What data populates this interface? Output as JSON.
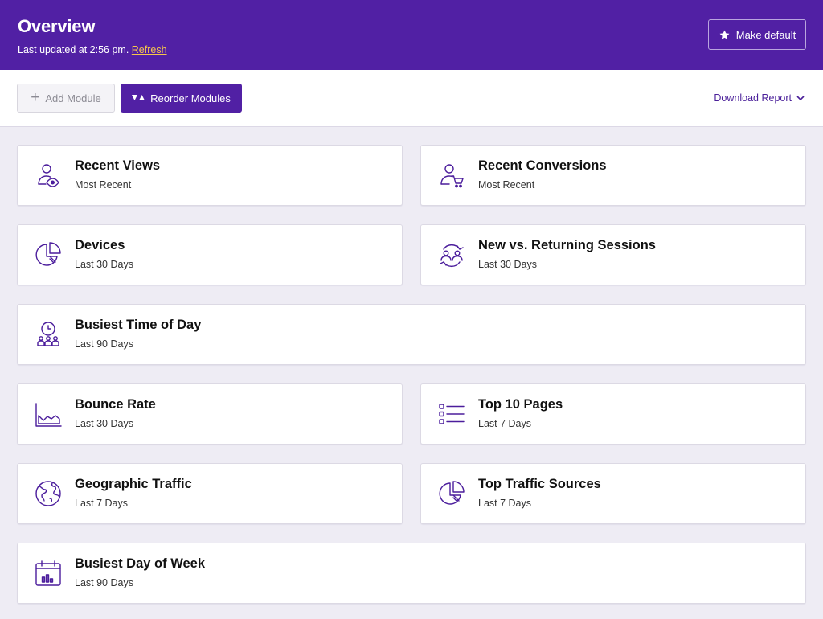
{
  "header": {
    "title": "Overview",
    "last_updated": "Last updated at 2:56 pm.",
    "refresh_label": "Refresh",
    "make_default_label": "Make default",
    "background_color": "#5120a4"
  },
  "toolbar": {
    "add_module_label": "Add Module",
    "reorder_modules_label": "Reorder Modules",
    "download_report_label": "Download Report"
  },
  "modules": [
    {
      "title": "Recent Views",
      "subtitle": "Most Recent",
      "icon": "user-eye-icon"
    },
    {
      "title": "Recent Conversions",
      "subtitle": "Most Recent",
      "icon": "user-cart-icon"
    },
    {
      "title": "Devices",
      "subtitle": "Last 30 Days",
      "icon": "pie-chart-icon"
    },
    {
      "title": "New vs. Returning Sessions",
      "subtitle": "Last 30 Days",
      "icon": "users-cycle-icon"
    },
    {
      "title": "Busiest Time of Day",
      "subtitle": "Last 90 Days",
      "icon": "clock-group-icon"
    },
    {
      "title": "Bounce Rate",
      "subtitle": "Last 30 Days",
      "icon": "area-chart-icon"
    },
    {
      "title": "Top 10 Pages",
      "subtitle": "Last 7 Days",
      "icon": "checklist-icon"
    },
    {
      "title": "Geographic Traffic",
      "subtitle": "Last 7 Days",
      "icon": "globe-icon"
    },
    {
      "title": "Top Traffic Sources",
      "subtitle": "Last 7 Days",
      "icon": "pie-chart-icon"
    },
    {
      "title": "Busiest Day of Week",
      "subtitle": "Last 90 Days",
      "icon": "calendar-chart-icon"
    }
  ],
  "accent_color": "#4b1d9c"
}
